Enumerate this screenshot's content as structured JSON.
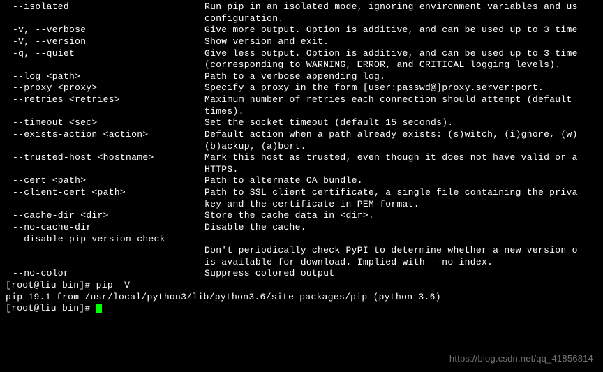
{
  "options": [
    {
      "flag": "--isolated",
      "desc": [
        "Run pip in an isolated mode, ignoring environment variables and us",
        "configuration."
      ]
    },
    {
      "flag": "-v, --verbose",
      "desc": [
        "Give more output. Option is additive, and can be used up to 3 time"
      ]
    },
    {
      "flag": "-V, --version",
      "desc": [
        "Show version and exit."
      ]
    },
    {
      "flag": "-q, --quiet",
      "desc": [
        "Give less output. Option is additive, and can be used up to 3 time",
        "(corresponding to WARNING, ERROR, and CRITICAL logging levels)."
      ]
    },
    {
      "flag": "--log <path>",
      "desc": [
        "Path to a verbose appending log."
      ]
    },
    {
      "flag": "--proxy <proxy>",
      "desc": [
        "Specify a proxy in the form [user:passwd@]proxy.server:port."
      ]
    },
    {
      "flag": "--retries <retries>",
      "desc": [
        "Maximum number of retries each connection should attempt (default ",
        "times)."
      ]
    },
    {
      "flag": "--timeout <sec>",
      "desc": [
        "Set the socket timeout (default 15 seconds)."
      ]
    },
    {
      "flag": "--exists-action <action>",
      "desc": [
        "Default action when a path already exists: (s)witch, (i)gnore, (w)",
        "(b)ackup, (a)bort."
      ]
    },
    {
      "flag": "--trusted-host <hostname>",
      "desc": [
        "Mark this host as trusted, even though it does not have valid or a",
        "HTTPS."
      ]
    },
    {
      "flag": "--cert <path>",
      "desc": [
        "Path to alternate CA bundle."
      ]
    },
    {
      "flag": "--client-cert <path>",
      "desc": [
        "Path to SSL client certificate, a single file containing the priva",
        "key and the certificate in PEM format."
      ]
    },
    {
      "flag": "--cache-dir <dir>",
      "desc": [
        "Store the cache data in <dir>."
      ]
    },
    {
      "flag": "--no-cache-dir",
      "desc": [
        "Disable the cache."
      ]
    },
    {
      "flag": "--disable-pip-version-check",
      "desc": [
        "",
        "Don't periodically check PyPI to determine whether a new version o",
        "is available for download. Implied with --no-index."
      ]
    },
    {
      "flag": "--no-color",
      "desc": [
        "Suppress colored output"
      ]
    }
  ],
  "line1": {
    "prompt": "[root@liu bin]# ",
    "cmd": "pip -V"
  },
  "line2": "pip 19.1 from /usr/local/python3/lib/python3.6/site-packages/pip (python 3.6)",
  "line3": {
    "prompt": "[root@liu bin]# "
  },
  "watermark": "https://blog.csdn.net/qq_41856814"
}
